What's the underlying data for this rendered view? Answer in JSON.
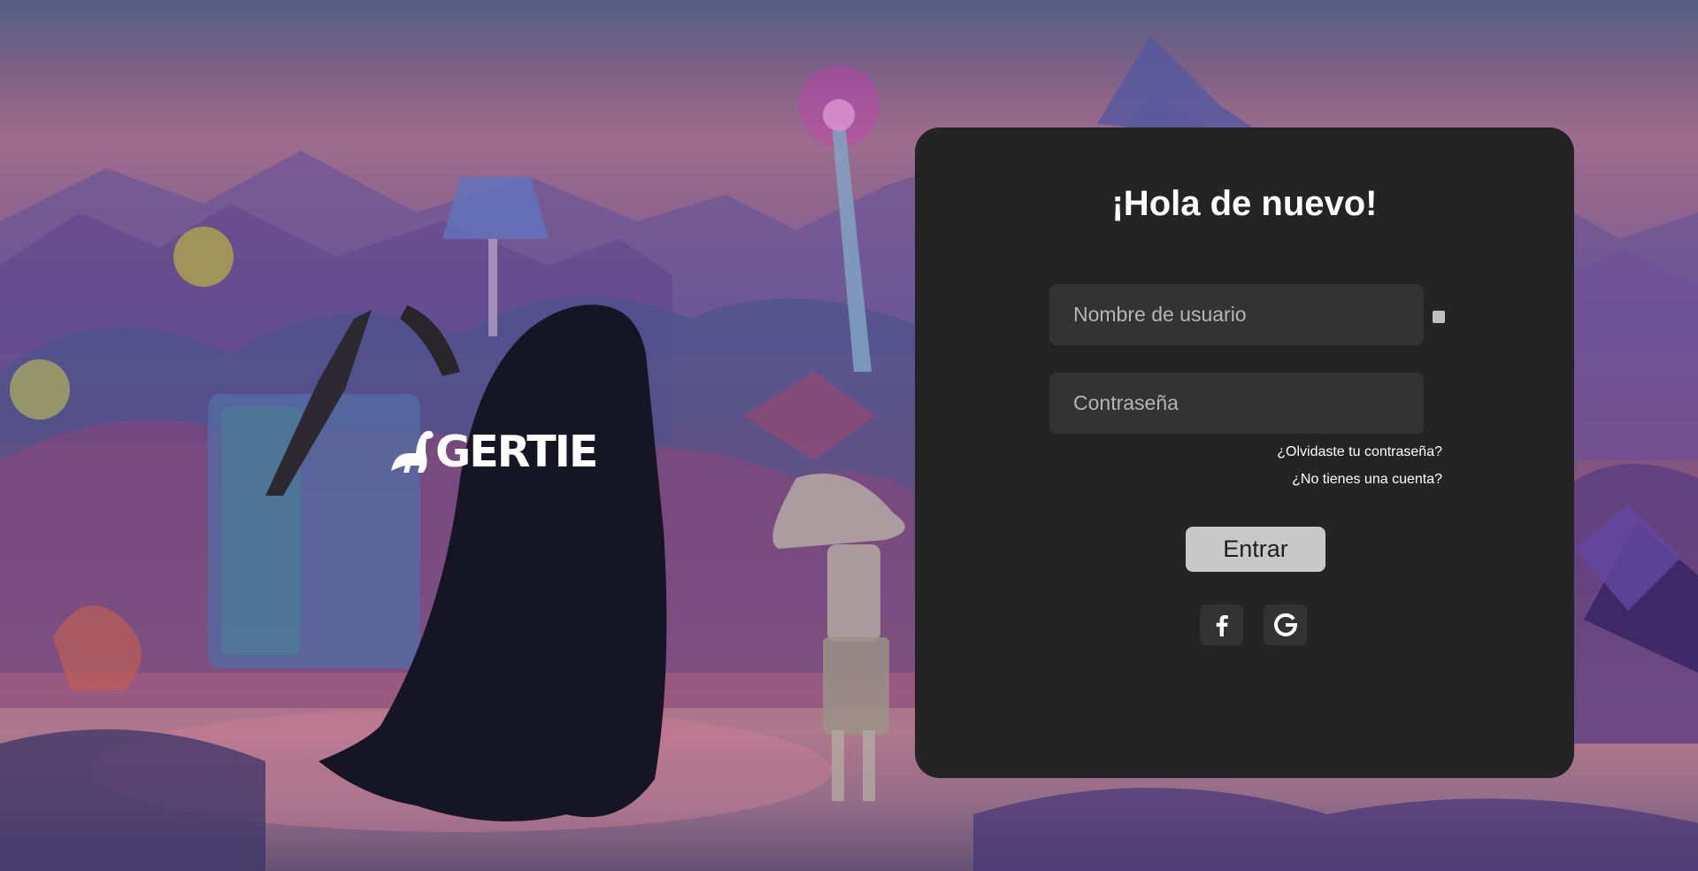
{
  "brand": {
    "name": "GERTIE",
    "logo_icon": "dino-icon"
  },
  "login": {
    "title": "¡Hola de nuevo!",
    "username_placeholder": "Nombre de usuario",
    "username_value": "",
    "password_placeholder": "Contraseña",
    "password_value": "",
    "forgot_password": "¿Olvidaste tu contraseña?",
    "no_account": "¿No tienes una cuenta?",
    "submit_label": "Entrar",
    "social": [
      {
        "icon": "facebook-icon"
      },
      {
        "icon": "google-icon"
      }
    ]
  },
  "colors": {
    "card_background": "#242424",
    "field_background": "#333333",
    "button_background": "#c8c8c8",
    "text_primary": "#ffffff"
  }
}
